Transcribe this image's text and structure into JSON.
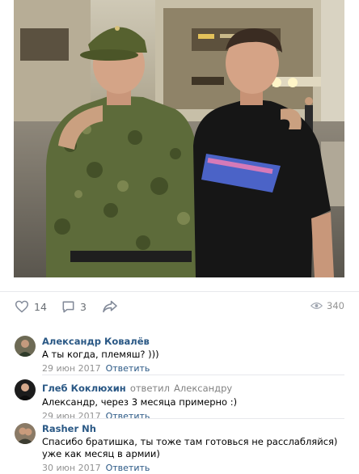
{
  "post": {
    "likes": "14",
    "comments_count": "3",
    "views": "340"
  },
  "comments": [
    {
      "author": "Александр Ковалёв",
      "text": "А ты когда, племяш? )))",
      "date": "29 июн 2017",
      "reply_label": "Ответить"
    },
    {
      "author": "Глеб Коклюхин",
      "replied_label": "ответил",
      "replied_to": "Александру",
      "text": "Александр, через 3 месяца примерно :)",
      "date": "29 июн 2017",
      "reply_label": "Ответить"
    },
    {
      "author": "Rasher Nh",
      "text": "Спасибо братишка, ты тоже там готовься не расслабляйся) уже как месяц в армии)",
      "date": "30 июн 2017",
      "reply_label": "Ответить"
    }
  ],
  "colors": {
    "link": "#2a5885",
    "muted": "#939393",
    "divider": "#e7e8ec",
    "icon": "#828a99"
  },
  "icons": {
    "like": "heart-icon",
    "comment": "speech-bubble-icon",
    "share": "share-arrow-icon",
    "views": "eye-icon"
  }
}
